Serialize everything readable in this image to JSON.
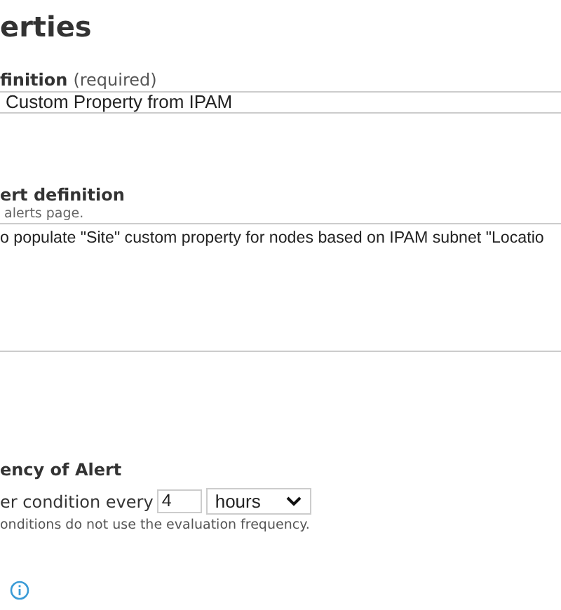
{
  "heading": "erties",
  "name_field": {
    "label": "finition",
    "hint": "(required)",
    "value": "Custom Property from IPAM"
  },
  "description_field": {
    "label": "ert definition",
    "help": "alerts page.",
    "value": "o populate \"Site\" custom property for nodes based on IPAM subnet \"Locatio"
  },
  "frequency": {
    "title": "ency of Alert",
    "prefix": "er condition every",
    "amount": "4",
    "unit": "hours",
    "note": "onditions do not use the evaluation frequency."
  }
}
